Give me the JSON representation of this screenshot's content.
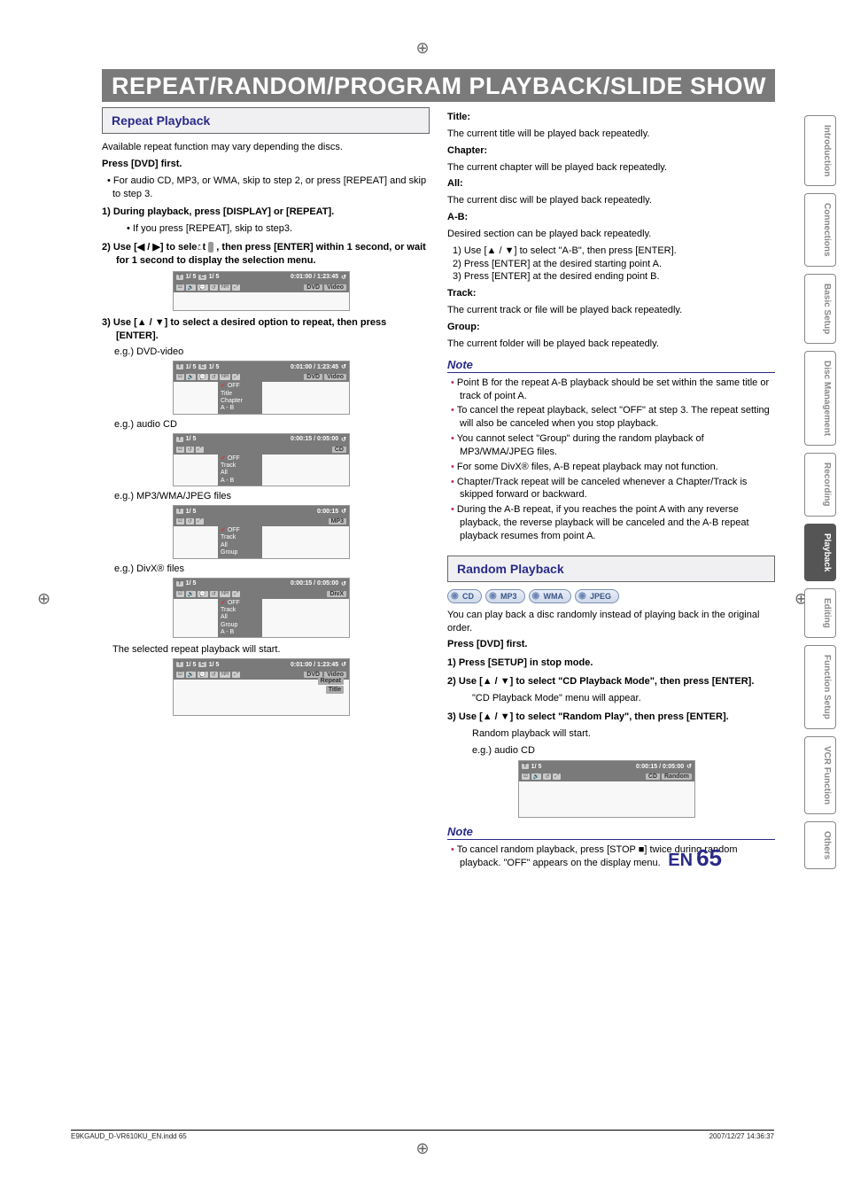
{
  "banner": "REPEAT/RANDOM/PROGRAM PLAYBACK/SLIDE SHOW",
  "left": {
    "section_title": "Repeat Playback",
    "intro": "Available repeat function may vary depending the discs.",
    "press_first": "Press [DVD] first.",
    "bullet1": "For audio CD, MP3, or WMA, skip to step 2, or press [REPEAT] and skip to step 3.",
    "step1": "1) During playback, press [DISPLAY] or [REPEAT].",
    "step1_sub": "• If you press [REPEAT], skip to step3.",
    "step2a": "2) Use [◀ / ▶] to select ",
    "step2_icon": "↺",
    "step2b": " , then press [ENTER] within 1 second, or wait for 1 second to display the selection menu.",
    "step3": "3) Use [▲ / ▼] to select a desired option to repeat, then press [ENTER].",
    "eg_dvd": "e.g.) DVD-video",
    "eg_cd": "e.g.) audio CD",
    "eg_mp3": "e.g.) MP3/WMA/JPEG files",
    "eg_divx": "e.g.) DivX® files",
    "selected_line": "The selected repeat playback will start.",
    "displays": {
      "simple": {
        "t": "1/  5",
        "c": "1/  5",
        "time": "0:01:00 / 1:23:45",
        "badge1": "DVD",
        "badge2": "Video"
      },
      "dvd": {
        "t": "1/  5",
        "c": "1/  5",
        "time": "0:01:00 / 1:23:45",
        "badge1": "DVD",
        "badge2": "Video",
        "menu": [
          "OFF",
          "Title",
          "Chapter",
          "A - B"
        ]
      },
      "cd": {
        "t": "1/  5",
        "time": "0:00:15 / 0:05:00",
        "badge1": "CD",
        "menu": [
          "OFF",
          "Track",
          "All",
          "A - B"
        ]
      },
      "mp3": {
        "t": "1/  5",
        "time": "0:00:15",
        "badge1": "MP3",
        "menu": [
          "OFF",
          "Track",
          "All",
          "Group"
        ]
      },
      "divx": {
        "t": "1/  5",
        "time": "0:00:15 / 0:05:00",
        "badge1": "DivX",
        "menu": [
          "OFF",
          "Track",
          "All",
          "Group",
          "A - B"
        ]
      },
      "final": {
        "t": "1/  5",
        "c": "1/  5",
        "time": "0:01:00 / 1:23:45",
        "badge1": "DVD",
        "badge2": "Video",
        "menu": [
          "Repeat",
          "Title"
        ]
      }
    }
  },
  "right": {
    "defs": {
      "title_l": "Title:",
      "title_t": "The current title will be played back repeatedly.",
      "chapter_l": "Chapter:",
      "chapter_t": "The current chapter will be played back repeatedly.",
      "all_l": "All:",
      "all_t": "The current disc will be played back repeatedly.",
      "ab_l": "A-B:",
      "ab_t": "Desired section can be played back repeatedly.",
      "ab_1": "1) Use [▲ / ▼] to select \"A-B\", then press [ENTER].",
      "ab_2": "2) Press [ENTER] at the desired starting point A.",
      "ab_3": "3) Press [ENTER] at the desired ending point B.",
      "track_l": "Track:",
      "track_t": "The current track or file will be played back repeatedly.",
      "group_l": "Group:",
      "group_t": "The current folder will be played back repeatedly."
    },
    "note_head": "Note",
    "notes": [
      "Point B for the repeat A-B playback should be set within the same title or track of point A.",
      "To cancel the repeat playback, select \"OFF\" at step 3. The repeat setting will also be canceled when you stop playback.",
      "You cannot select \"Group\" during the random playback of MP3/WMA/JPEG files.",
      "For some DivX® files, A-B repeat playback may not function.",
      "Chapter/Track repeat will be canceled whenever a Chapter/Track is skipped forward or backward.",
      "During the A-B repeat, if you reaches the point A with any reverse playback, the reverse playback will be canceled and the A-B repeat playback resumes from point A."
    ],
    "random_title": "Random Playback",
    "media": [
      "CD",
      "MP3",
      "WMA",
      "JPEG"
    ],
    "random_intro": "You can play back a disc randomly instead of playing back in the original order.",
    "random_press": "Press [DVD] first.",
    "r_step1": "1) Press [SETUP] in stop mode.",
    "r_step2": "2) Use [▲ / ▼] to select \"CD Playback Mode\", then press [ENTER].",
    "r_step2_sub": "\"CD Playback Mode\" menu will appear.",
    "r_step3": "3) Use [▲ / ▼] to select \"Random Play\", then press [ENTER].",
    "r_step3_sub": "Random playback will start.",
    "r_eg": "e.g.) audio CD",
    "r_display": {
      "t": "1/  5",
      "time": "0:00:15 / 0:05:00",
      "badge1": "CD",
      "badge2": "Random"
    },
    "r_note_head": "Note",
    "r_note": "To cancel random playback, press [STOP ■] twice during random playback. \"OFF\" appears on the display menu."
  },
  "tabs": [
    "Introduction",
    "Connections",
    "Basic Setup",
    "Disc Management",
    "Recording",
    "Playback",
    "Editing",
    "Function Setup",
    "VCR Function",
    "Others"
  ],
  "active_tab": "Playback",
  "page": {
    "lang": "EN",
    "num": "65"
  },
  "footer": {
    "file": "E9KGAUD_D-VR610KU_EN.indd   65",
    "stamp": "2007/12/27   14:36:37"
  }
}
